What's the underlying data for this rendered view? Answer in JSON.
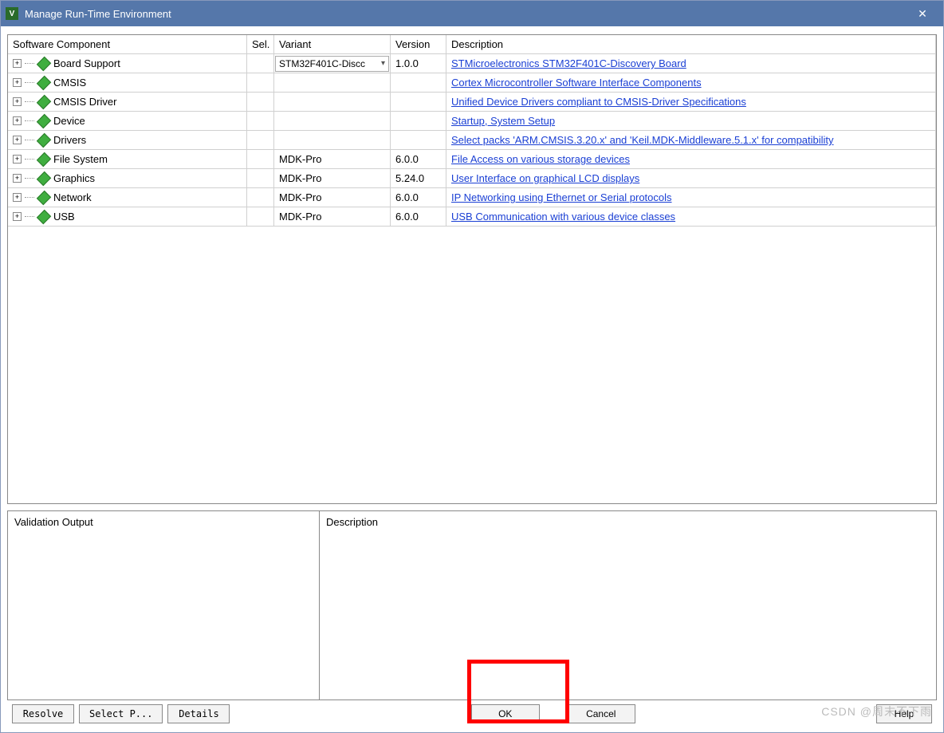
{
  "window": {
    "title": "Manage Run-Time Environment"
  },
  "headers": {
    "component": "Software Component",
    "sel": "Sel.",
    "variant": "Variant",
    "version": "Version",
    "description": "Description"
  },
  "rows": [
    {
      "name": "Board Support",
      "sel": false,
      "variant": "STM32F401C-Discc",
      "variant_dd": true,
      "version": "1.0.0",
      "desc": "STMicroelectronics STM32F401C-Discovery Board",
      "link": true
    },
    {
      "name": "CMSIS",
      "sel": false,
      "variant": "",
      "version": "",
      "desc": "Cortex Microcontroller Software Interface Components",
      "link": true
    },
    {
      "name": "CMSIS Driver",
      "sel": false,
      "variant": "",
      "version": "",
      "desc": "Unified Device Drivers compliant to CMSIS-Driver Specifications",
      "link": true
    },
    {
      "name": "Device",
      "sel": false,
      "variant": "",
      "version": "",
      "desc": "Startup, System Setup",
      "link": true
    },
    {
      "name": "Drivers",
      "sel": false,
      "variant": "",
      "version": "",
      "desc": "Select packs 'ARM.CMSIS.3.20.x' and 'Keil.MDK-Middleware.5.1.x' for compatibility",
      "link": true
    },
    {
      "name": "File System",
      "sel": false,
      "variant": "MDK-Pro",
      "version": "6.0.0",
      "desc": "File Access on various storage devices",
      "link": true
    },
    {
      "name": "Graphics",
      "sel": false,
      "variant": "MDK-Pro",
      "version": "5.24.0",
      "desc": "User Interface on graphical LCD displays",
      "link": true
    },
    {
      "name": "Network",
      "sel": false,
      "variant": "MDK-Pro",
      "version": "6.0.0",
      "desc": "IP Networking using Ethernet or Serial protocols",
      "link": true
    },
    {
      "name": "USB",
      "sel": false,
      "variant": "MDK-Pro",
      "version": "6.0.0",
      "desc": "USB Communication with various device classes",
      "link": true
    }
  ],
  "panels": {
    "validation": "Validation Output",
    "description": "Description"
  },
  "buttons": {
    "resolve": "Resolve",
    "select": "Select P...",
    "details": "Details",
    "ok": "OK",
    "cancel": "Cancel",
    "help": "Help"
  },
  "watermark": "CSDN @周末不下雨"
}
